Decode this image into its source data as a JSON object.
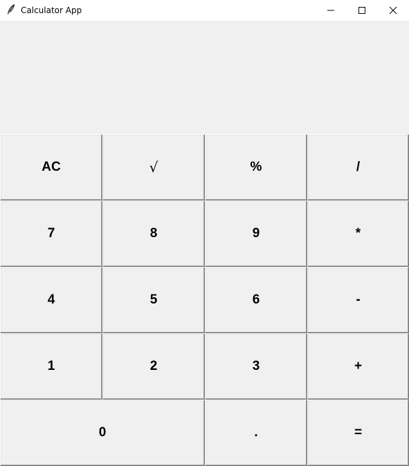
{
  "window": {
    "title": "Calculator App",
    "icon": "feather-icon",
    "controls": {
      "minimize": "minimize-icon",
      "maximize": "maximize-icon",
      "close": "close-icon"
    }
  },
  "display": {
    "value": ""
  },
  "keys": {
    "ac": "AC",
    "sqrt": "√",
    "percent": "%",
    "divide": "/",
    "seven": "7",
    "eight": "8",
    "nine": "9",
    "multiply": "*",
    "four": "4",
    "five": "5",
    "six": "6",
    "subtract": "-",
    "one": "1",
    "two": "2",
    "three": "3",
    "add": "+",
    "zero": "0",
    "decimal": ".",
    "equals": "="
  }
}
